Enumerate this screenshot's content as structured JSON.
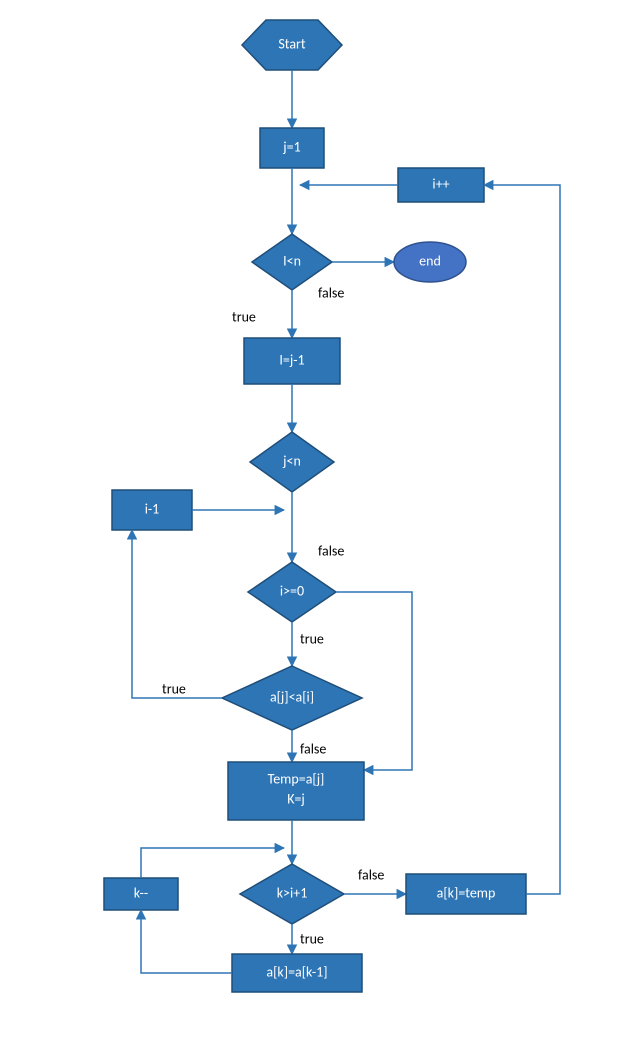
{
  "colors": {
    "fill": "#2e75b6",
    "stroke": "#1f4e79",
    "end_fill": "#4472c4",
    "connector": "#2e75b6",
    "text_in": "#ffffff",
    "text_out": "#000000"
  },
  "nodes": {
    "start": "Start",
    "init_j": "j=1",
    "inc_i": "i++",
    "cond_In": "I<n",
    "end": "end",
    "assign_Ij": "I=j-1",
    "cond_jn": "j<n",
    "i_minus_1": "i-1",
    "cond_ige0": "i>=0",
    "cond_aj_lt_ai": "a[j]<a[i]",
    "temp_line1": "Temp=a[j]",
    "temp_line2": "K=j",
    "cond_k_gt": "k>i+1",
    "ak_temp": "a[k]=temp",
    "k_dec": "k--",
    "ak_km1": "a[k]=a[k-1]"
  },
  "edge_labels": {
    "true": "true",
    "false": "false"
  }
}
